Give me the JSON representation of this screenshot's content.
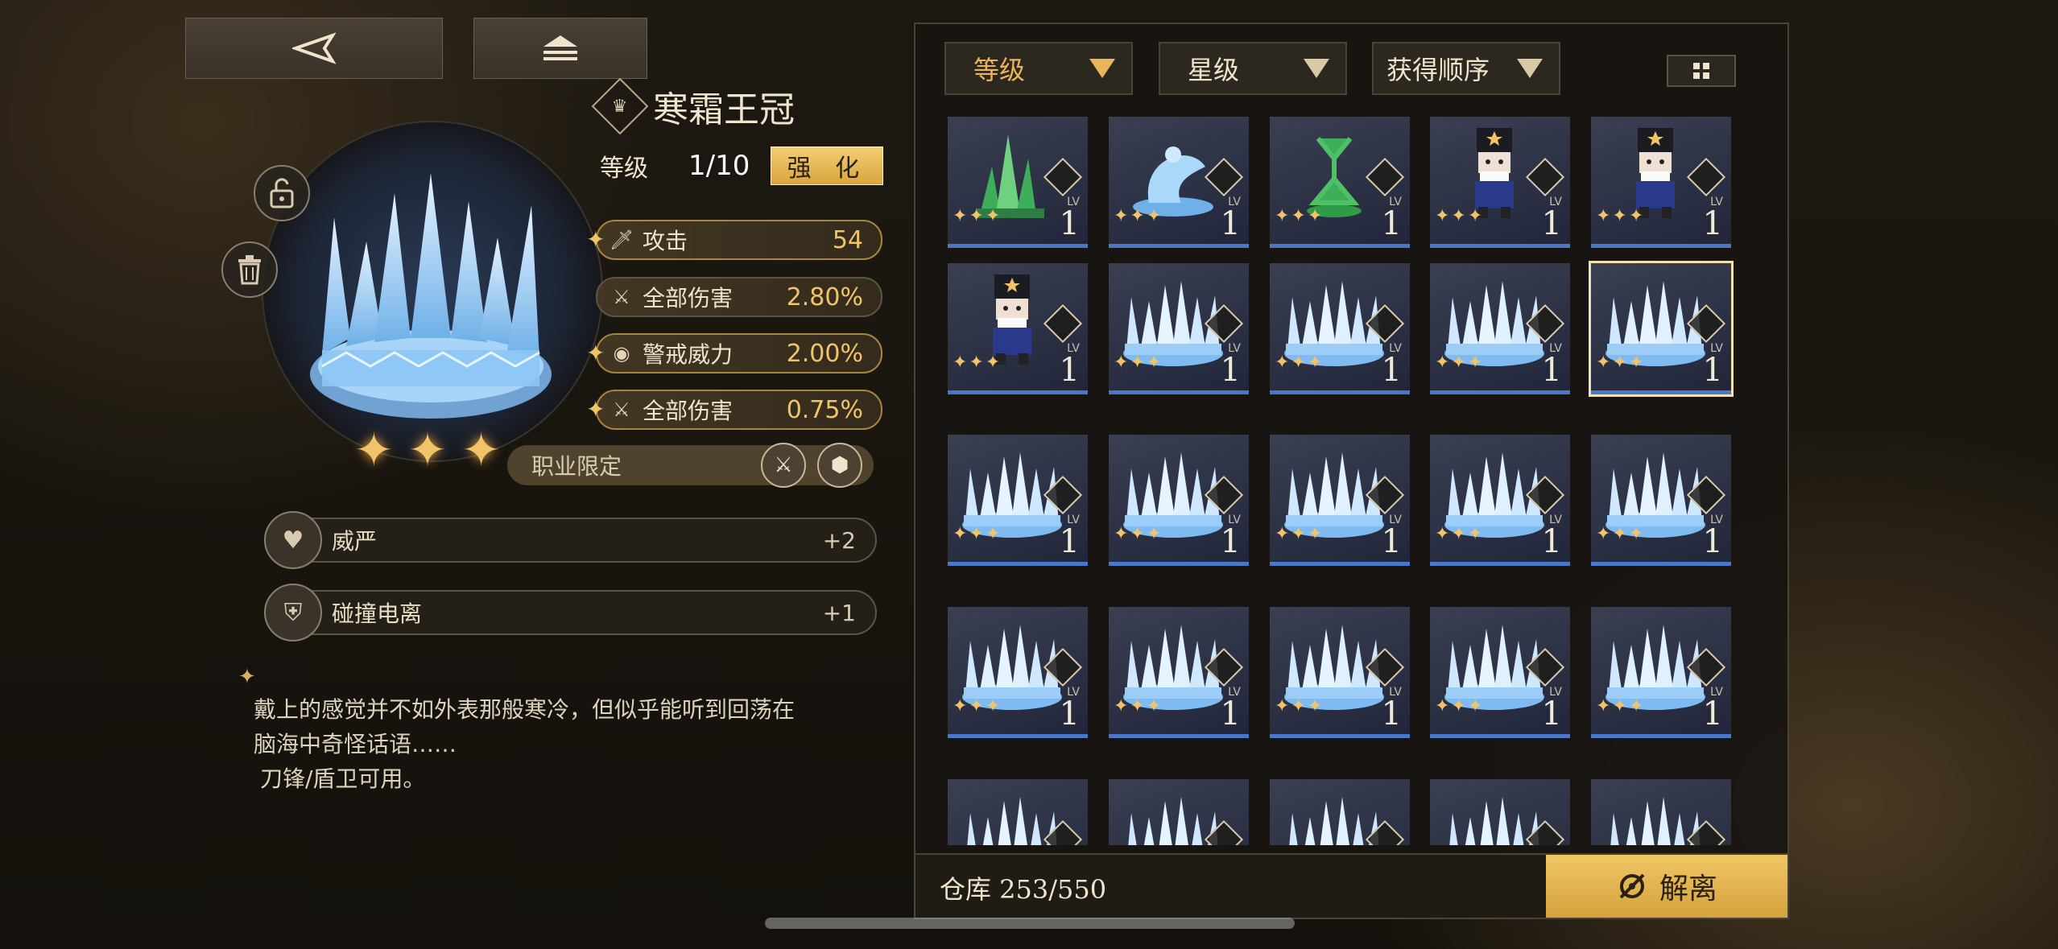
{
  "topbar": {
    "back_icon": "back-arrow-icon",
    "home_icon": "stack-home-icon"
  },
  "item": {
    "name": "寒霜王冠",
    "level_label": "等级",
    "level_value": "1/10",
    "upgrade_label": "强 化",
    "stars": 3,
    "stats": [
      {
        "icon": "sword-icon",
        "name": "攻击",
        "value": "54"
      },
      {
        "icon": "damage-icon",
        "name": "全部伤害",
        "value": "2.80%"
      },
      {
        "icon": "eye-icon",
        "name": "警戒威力",
        "value": "2.00%"
      },
      {
        "icon": "damage-icon",
        "name": "全部伤害",
        "value": "0.75%"
      }
    ],
    "class_limit_label": "职业限定",
    "perks": [
      {
        "icon": "heart-icon",
        "name": "威严",
        "value": "+2"
      },
      {
        "icon": "shield-icon",
        "name": "碰撞电离",
        "value": "+1"
      }
    ],
    "description_line1": "戴上的感觉并不如外表那般寒冷，但似乎能听到回荡在",
    "description_line2": "脑海中奇怪话语……",
    "description_line3": "刀锋/盾卫可用。"
  },
  "inventory": {
    "filters": [
      {
        "label": "等级",
        "active": true
      },
      {
        "label": "星级",
        "active": false
      },
      {
        "label": "获得顺序",
        "active": false
      }
    ],
    "lv_label": "LV",
    "items": [
      {
        "type": "green-crystal",
        "level": "1"
      },
      {
        "type": "blue-dancer",
        "level": "1"
      },
      {
        "type": "green-dancer",
        "level": "1"
      },
      {
        "type": "nutcracker",
        "level": "1"
      },
      {
        "type": "nutcracker",
        "level": "1"
      },
      {
        "type": "nutcracker",
        "level": "1"
      },
      {
        "type": "ice-crown",
        "level": "1"
      },
      {
        "type": "ice-crown",
        "level": "1"
      },
      {
        "type": "ice-crown",
        "level": "1"
      },
      {
        "type": "ice-crown",
        "level": "1",
        "selected": true
      },
      {
        "type": "ice-crown",
        "level": "1"
      },
      {
        "type": "ice-crown",
        "level": "1"
      },
      {
        "type": "ice-crown",
        "level": "1"
      },
      {
        "type": "ice-crown",
        "level": "1"
      },
      {
        "type": "ice-crown",
        "level": "1"
      },
      {
        "type": "ice-crown",
        "level": "1"
      },
      {
        "type": "ice-crown",
        "level": "1"
      },
      {
        "type": "ice-crown",
        "level": "1"
      },
      {
        "type": "ice-crown",
        "level": "1"
      },
      {
        "type": "ice-crown",
        "level": "1"
      },
      {
        "type": "ice-crown",
        "level": ""
      },
      {
        "type": "ice-crown",
        "level": ""
      },
      {
        "type": "ice-crown",
        "level": ""
      },
      {
        "type": "ice-crown",
        "level": ""
      },
      {
        "type": "ice-crown",
        "level": ""
      }
    ],
    "storage_label": "仓库 253/550",
    "disassemble_label": "解离"
  }
}
